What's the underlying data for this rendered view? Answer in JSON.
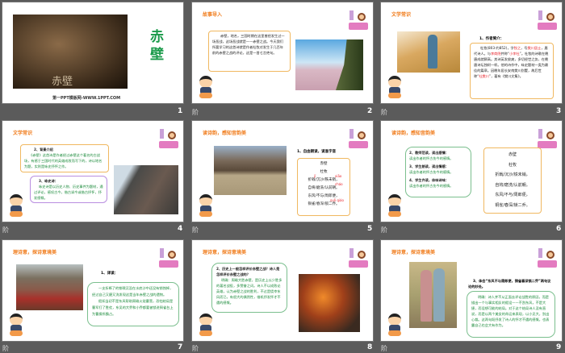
{
  "slides": [
    {
      "number": "1",
      "title": "赤壁",
      "footer": "第一PPT模板网-WWW.1PPT.COM",
      "poster_caption": "赤壁"
    },
    {
      "number": "2",
      "heading": "故事导入",
      "body": "赤壁，地名，三国时期在这里曾经发生过一场恶战，这场恶战就是——赤壁之战。今天我们所要学习的这首诗就是作者杜牧对发生于几百年前的赤壁之战的评论，这是一首七言绝句。"
    },
    {
      "number": "3",
      "heading": "文学常识",
      "subheading": "1、作者简介：",
      "body_a": "杜牧(803-约852)，字",
      "hl1": "牧之",
      "body_b": "，号",
      "hl2": "樊川居士",
      "body_c": "，唐代诗人。与",
      "hl3": "李商隐",
      "body_d": "并称“",
      "hl4": "小李杜",
      "body_e": "”。杜牧的诗歌在晚唐成就颇高。其诗英发俊爽，多切经世之务，在晚唐诗坛独树一帜。他的诗作中，咏史题材一类为最佳的篇章。因晚年居长安南樊川别墅，故后世称“",
      "hl5": "杜樊川",
      "body_f": "”，著有《樊川文集》。"
    },
    {
      "number": "4",
      "heading": "文学常识",
      "box1_title": "2、背景介绍",
      "box1_body": "《赤壁》这首诗是作者经过赤壁这个著名的古战场，有感于三国时代的英雄成败而写下的，诗以地名为题，实则是咏史抒怀之作。",
      "box2_title": "3、咏史诗：",
      "box2_body": "咏史诗是以历史人物、历史事件为题材，通过评论，感叹古今，借古讽今或借古抒怀，抒发感慨。"
    },
    {
      "number": "5",
      "heading": "读诗韵，感知音韵美",
      "subheading": "1、自由朗读，读准字音",
      "poem_title": "赤壁",
      "poem_author": "杜牧",
      "lines": [
        "折戟/沉沙/铁未销，",
        "自将/磨洗/认前朝。",
        "东风/不与/周郎便，",
        "铜雀/春深/锁二乔。"
      ],
      "pinyin": [
        "jǐ",
        "xiāo",
        "cháo",
        "suǒ qiáo"
      ]
    },
    {
      "number": "6",
      "heading": "读诗韵，感知音韵美",
      "steps": [
        {
          "t": "2、教师范读，读出感情：",
          "d": "读出作者的怀古伤今的感情。"
        },
        {
          "t": "3、学生朗读，读出情感：",
          "d": "读出作者的怀古伤今的感情。"
        },
        {
          "t": "4、学生齐读，体味诗味：",
          "d": "读出作者的怀古伤今的感情。"
        }
      ],
      "poem_title": "赤壁",
      "poem_author": "杜牧",
      "lines": [
        "折戟/沉沙/铁未销，",
        "自将/磨洗/认前朝。",
        "东风/不与/周郎便，",
        "铜雀/春深/锁二乔。"
      ]
    },
    {
      "number": "7",
      "heading": "理诗意，探诗意境美",
      "subheading": "1、译读：",
      "p1": "一支折断了的铁戟沉没在水底沙中还没有销蚀掉，经过自己又磨又洗发现这是当年赤壁之战的遗物。",
      "p2": "假如当初不是东风帮助周瑜火烧曹营，恐怕结局是曹军打了胜仗，东吴的大乔和小乔都要被锁进铜雀台上为曹操所霸占。"
    },
    {
      "number": "8",
      "heading": "理诗意，探诗意境美",
      "question": "2、历史上一般怎样评价赤壁之战？诗人是怎样评价赤壁之战的？",
      "answer": "明确：周瑜大胜赤壁，是历史上以少胜多的著名战役，多赞誉之词。诗人不以成败论英雄，认为赤壁之战的胜利，不过是侥幸东风而已，有很大的偶然性，借机抒发怀才不遇的感慨。"
    },
    {
      "number": "9",
      "heading": "理诗意，探诗意境美",
      "question": "3、体会“东风不与周郎便，铜雀春深锁二乔”两句议论的妙处。",
      "answer": "明确：诗人并不从正面去评论战胜的原因，而是描出一个与事实相反的假设——不刮东风，不是大捷，而设想可能的结局。对于这个结局诗人没有直说，而是以两个美女的命运来表现，以小见大，别出心裁。这两句既抒发了诗人的怀才不遇的感慨，也表露自己也会大有作为。"
    }
  ],
  "transition_icon_label": "阶"
}
